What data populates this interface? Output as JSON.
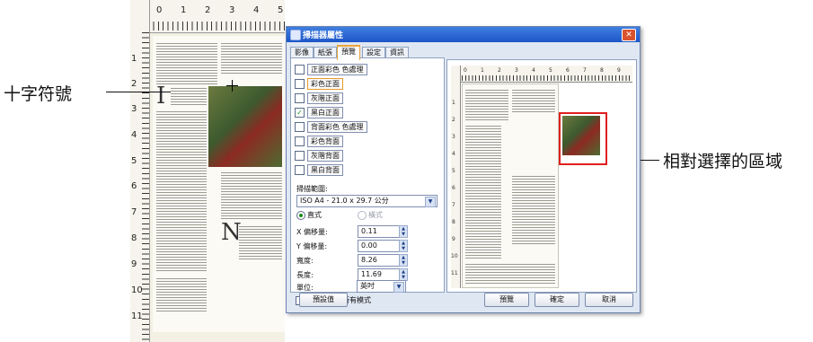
{
  "background_document": {
    "top_ruler_numbers": [
      "0",
      "1",
      "2",
      "3",
      "4",
      "5",
      "6",
      "7",
      "8",
      "9"
    ],
    "left_ruler_numbers": [
      "1",
      "2",
      "3",
      "4",
      "5",
      "6",
      "7",
      "8",
      "9",
      "10",
      "11"
    ]
  },
  "annotations": {
    "crosshair_label": "十字符號",
    "selection_label": "相對選擇的區域"
  },
  "dialog": {
    "title": "掃描器屬性",
    "tabs": [
      "影像",
      "紙張",
      "預覽",
      "設定",
      "資訊"
    ],
    "active_tab": "預覽",
    "image_types": [
      {
        "label": "正面彩色 色處理",
        "checked": false,
        "focused": false
      },
      {
        "label": "彩色正面",
        "checked": false,
        "focused": true
      },
      {
        "label": "灰階正面",
        "checked": false,
        "focused": false
      },
      {
        "label": "黑白正面",
        "checked": true,
        "focused": false
      },
      {
        "label": "背面彩色 色處理",
        "checked": false,
        "focused": false
      },
      {
        "label": "彩色背面",
        "checked": false,
        "focused": false
      },
      {
        "label": "灰階背面",
        "checked": false,
        "focused": false
      },
      {
        "label": "黑白背面",
        "checked": false,
        "focused": false
      }
    ],
    "scan_area": {
      "label": "掃描範圍:",
      "value": "ISO A4 - 21.0 x 29.7 公分",
      "orientation_portrait": "直式",
      "orientation_landscape": "橫式"
    },
    "fields": {
      "x_offset": {
        "label": "X 偏移量:",
        "value": "0.11"
      },
      "y_offset": {
        "label": "Y 偏移量:",
        "value": "0.00"
      },
      "width": {
        "label": "寬度:",
        "value": "8.26"
      },
      "height": {
        "label": "長度:",
        "value": "11.69"
      },
      "unit": {
        "label": "單位:",
        "value": "英吋"
      }
    },
    "apply_all_label": "範圍套用於所有模式",
    "preview_ruler_top": [
      "0",
      "1",
      "2",
      "3",
      "4",
      "5",
      "6",
      "7",
      "8",
      "9"
    ],
    "preview_ruler_left": [
      "1",
      "2",
      "3",
      "4",
      "5",
      "6",
      "7",
      "8",
      "9",
      "10",
      "11"
    ],
    "buttons": {
      "default": "預設值",
      "preview": "預覽",
      "ok": "確定",
      "cancel": "取消"
    }
  }
}
